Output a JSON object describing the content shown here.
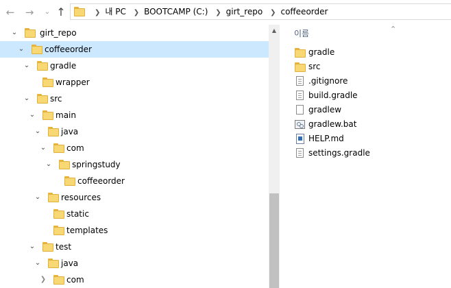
{
  "nav": {
    "back_icon": "back-arrow-icon",
    "forward_icon": "forward-arrow-icon",
    "dropdown_icon": "chevron-down-icon",
    "up_icon": "up-arrow-icon"
  },
  "address": {
    "crumbs": [
      "내 PC",
      "BOOTCAMP (C:)",
      "girt_repo",
      "coffeeorder"
    ]
  },
  "tree": {
    "items": [
      {
        "label": "girt_repo",
        "expanded": true
      },
      {
        "label": "coffeeorder",
        "expanded": true,
        "selected": true
      },
      {
        "label": "gradle",
        "expanded": true
      },
      {
        "label": "wrapper",
        "expanded": false
      },
      {
        "label": "src",
        "expanded": true
      },
      {
        "label": "main",
        "expanded": true
      },
      {
        "label": "java",
        "expanded": true
      },
      {
        "label": "com",
        "expanded": true
      },
      {
        "label": "springstudy",
        "expanded": true
      },
      {
        "label": "coffeeorder",
        "expanded": false
      },
      {
        "label": "resources",
        "expanded": true
      },
      {
        "label": "static",
        "expanded": false
      },
      {
        "label": "templates",
        "expanded": false
      },
      {
        "label": "test",
        "expanded": true
      },
      {
        "label": "java",
        "expanded": true
      },
      {
        "label": "com",
        "expanded": false
      }
    ]
  },
  "list": {
    "column_name": "이름",
    "items": [
      {
        "label": "gradle",
        "icon": "folder-icon"
      },
      {
        "label": "src",
        "icon": "folder-icon"
      },
      {
        "label": ".gitignore",
        "icon": "text-file-icon"
      },
      {
        "label": "build.gradle",
        "icon": "text-file-icon"
      },
      {
        "label": "gradlew",
        "icon": "blank-file-icon"
      },
      {
        "label": "gradlew.bat",
        "icon": "batch-file-icon"
      },
      {
        "label": "HELP.md",
        "icon": "markdown-file-icon"
      },
      {
        "label": "settings.gradle",
        "icon": "text-file-icon"
      }
    ]
  },
  "colors": {
    "selection": "#cce8ff",
    "folder": "#f8d775",
    "header_text": "#4c607a"
  }
}
